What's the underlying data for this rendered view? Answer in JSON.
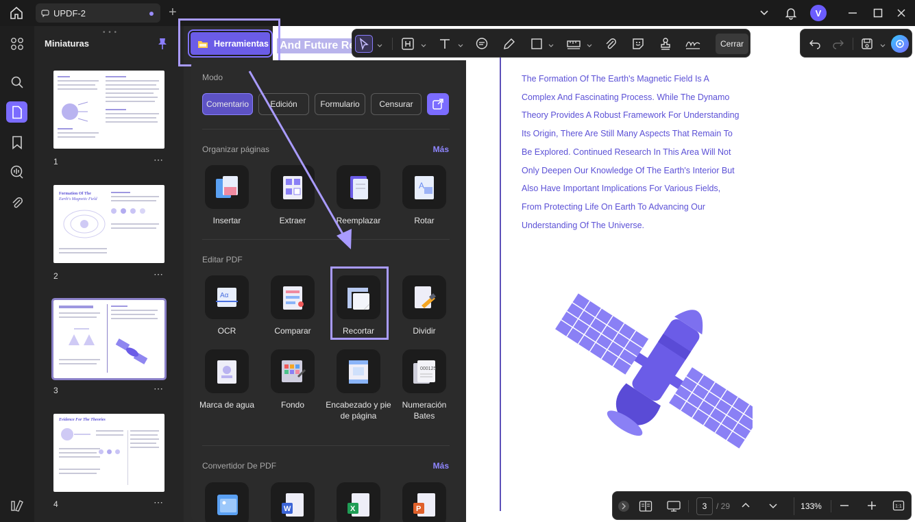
{
  "titlebar": {
    "tab_title": "UPDF-2",
    "avatar_initial": "V"
  },
  "thumbnails": {
    "title": "Miniaturas",
    "pages": [
      {
        "number": "1",
        "more": "⋯"
      },
      {
        "number": "2",
        "more": "⋯"
      },
      {
        "number": "3",
        "more": "⋯"
      },
      {
        "number": "4",
        "more": "⋯"
      }
    ]
  },
  "toolbar": {
    "tools_button": "Herramientas",
    "close_label": "Cerrar"
  },
  "behind_title": "And Future Re",
  "panel": {
    "mode_title": "Modo",
    "modes": [
      "Comentario",
      "Edición",
      "Formulario",
      "Censurar"
    ],
    "organize": {
      "title": "Organizar páginas",
      "more": "Más",
      "items": [
        "Insertar",
        "Extraer",
        "Reemplazar",
        "Rotar"
      ]
    },
    "edit": {
      "title": "Editar PDF",
      "items": [
        "OCR",
        "Comparar",
        "Recortar",
        "Dividir",
        "Marca de agua",
        "Fondo",
        "Encabezado y pie de página",
        "Numeración Bates"
      ]
    },
    "converter": {
      "title": "Convertidor De PDF",
      "more": "Más"
    }
  },
  "document": {
    "lines": [
      "The Formation Of The Earth's Magnetic Field Is A",
      "Complex And Fascinating Process. While The Dynamo",
      "Theory Provides A Robust Framework For Understanding",
      "Its Origin, There Are Still Many Aspects That Remain To",
      "Be Explored. Continued Research In This Area Will Not",
      "Only Deepen Our Knowledge Of The Earth's Interior But",
      "Also Have Important Implications For Various Fields,",
      "From Protecting Life On Earth To Advancing Our",
      "Understanding Of The Universe."
    ]
  },
  "bottombar": {
    "current_page": "3",
    "total_pages": "/ 29",
    "zoom": "133%"
  },
  "colors": {
    "accent": "#7b6cff",
    "doc_text": "#5b50d6",
    "highlight": "#a99bff"
  }
}
